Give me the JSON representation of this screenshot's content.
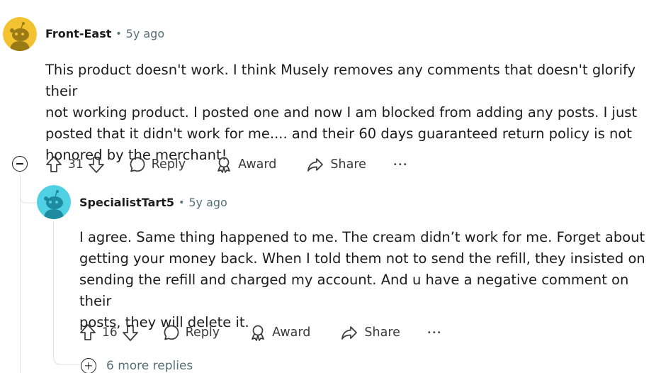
{
  "comment": {
    "author": "Front-East",
    "separator": "•",
    "time": "5y ago",
    "body": [
      "This product doesn't work. I think Musely removes any comments that doesn't glorify their",
      "not working product. I posted one and now I am blocked from adding any posts. I just",
      "posted that it didn't work for me.... and their 60 days guaranteed return policy is not",
      "honored by the merchant!"
    ],
    "votes": "31",
    "reply_label": "Reply",
    "award_label": "Award",
    "share_label": "Share",
    "more_icon": "•••",
    "avatar_color": "#f2c230"
  },
  "reply": {
    "author": "SpecialistTart5",
    "separator": "•",
    "time": "5y ago",
    "body": [
      "I agree. Same thing happened to me. The cream didn’t work for me. Forget about",
      "getting your money back. When I told them not to send the refill, they insisted on",
      "sending the refill and charged my account. And u have a negative comment on their",
      "posts, they will delete it."
    ],
    "votes": "16",
    "reply_label": "Reply",
    "award_label": "Award",
    "share_label": "Share",
    "more_icon": "•••",
    "avatar_color": "#4fd1e3"
  },
  "more_replies": {
    "label": "6 more replies"
  }
}
